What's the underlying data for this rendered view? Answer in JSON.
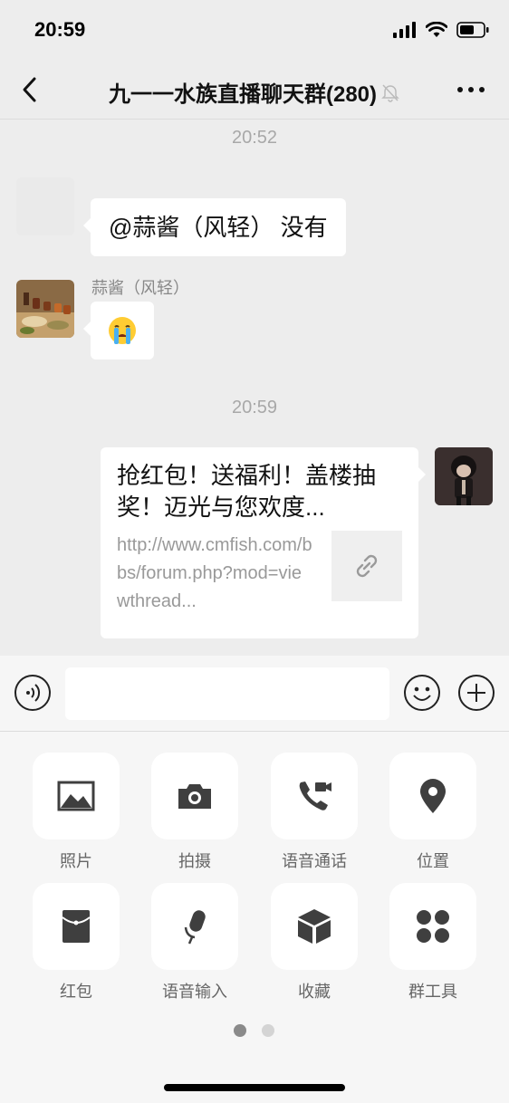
{
  "status_bar": {
    "time": "20:59"
  },
  "nav": {
    "title": "九一一水族直播聊天群(280)"
  },
  "messages": {
    "time_1": "20:52",
    "msg_1_text": "@蒜酱（风轻） 没有",
    "msg_2_sender": "蒜酱（风轻）",
    "msg_2_emoji": "😭",
    "time_2": "20:59",
    "link_title": "抢红包！送福利！盖楼抽奖！迈光与您欢度...",
    "link_url": "http://www.cmfish.com/bbs/forum.php?mod=viewthread..."
  },
  "input": {
    "value": "",
    "placeholder": ""
  },
  "tools": [
    {
      "label": "照片",
      "icon": "photo-icon"
    },
    {
      "label": "拍摄",
      "icon": "camera-icon"
    },
    {
      "label": "语音通话",
      "icon": "video-call-icon"
    },
    {
      "label": "位置",
      "icon": "location-icon"
    },
    {
      "label": "红包",
      "icon": "red-packet-icon"
    },
    {
      "label": "语音输入",
      "icon": "microphone-icon"
    },
    {
      "label": "收藏",
      "icon": "favorites-icon"
    },
    {
      "label": "群工具",
      "icon": "group-tools-icon"
    }
  ],
  "pager": {
    "current_page": 1,
    "total_pages": 2
  },
  "colors": {
    "background": "#ededed",
    "panel": "#f6f6f6",
    "icon": "#3f3f3f",
    "timestamp": "#a8a8a8"
  }
}
